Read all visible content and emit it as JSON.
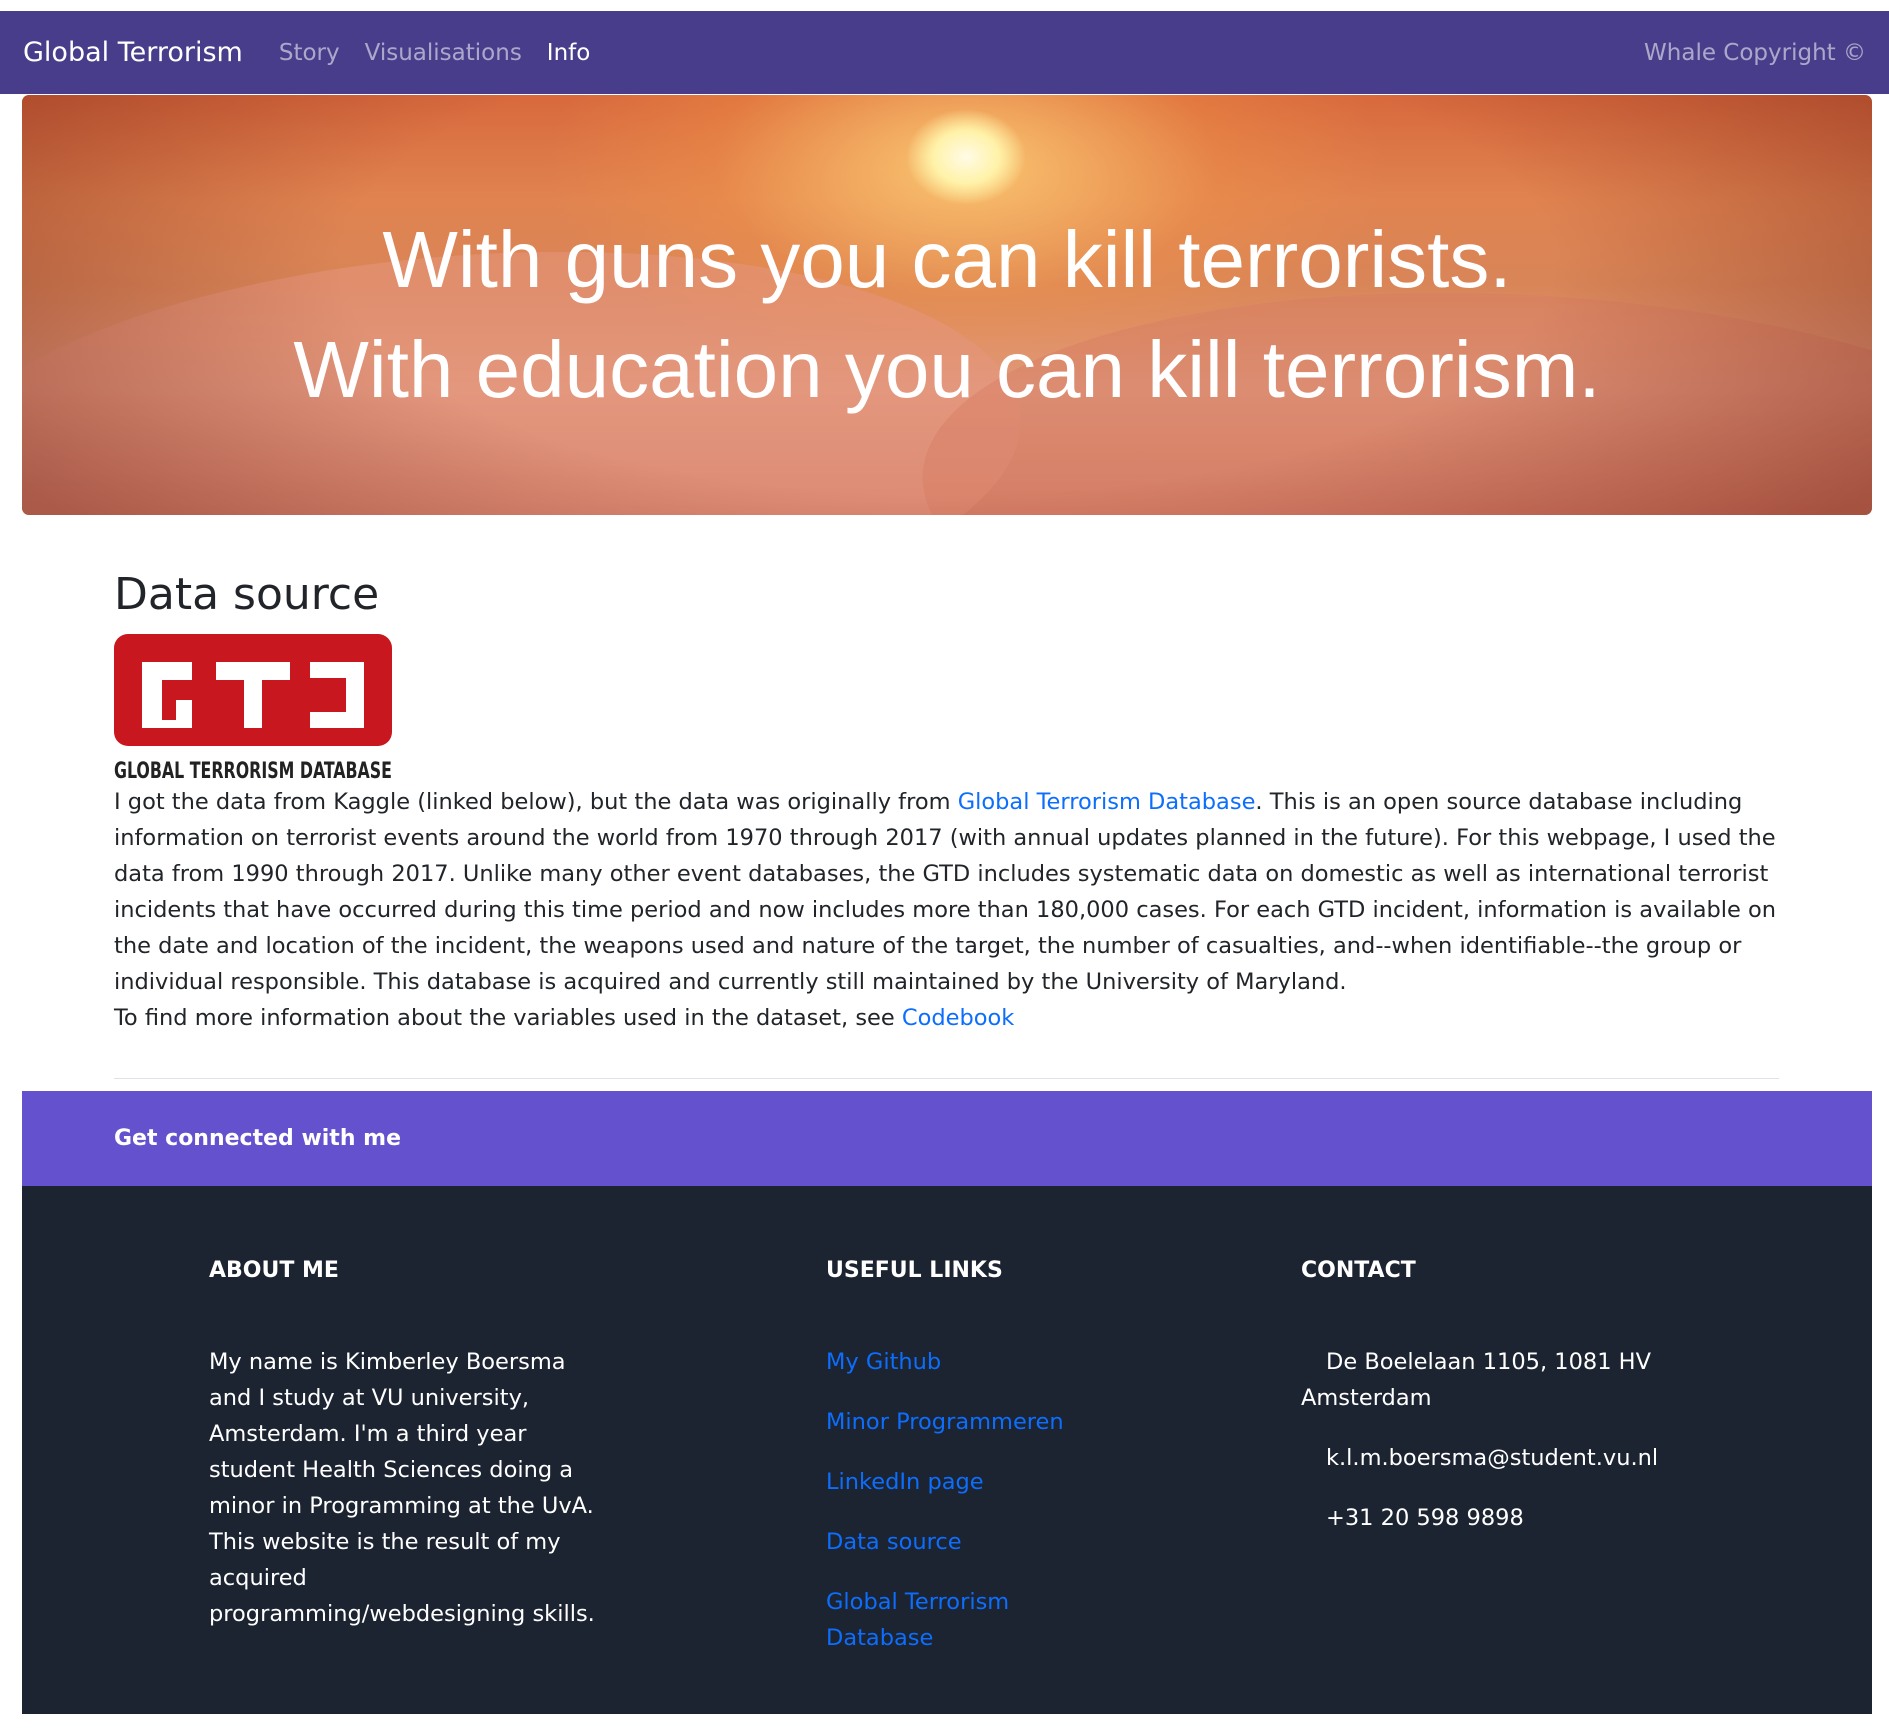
{
  "nav": {
    "brand": "Global Terrorism",
    "links": [
      "Story",
      "Visualisations",
      "Info"
    ],
    "active": "Info",
    "right": "Whale Copyright ©"
  },
  "hero": {
    "line1": "With guns you can kill terrorists.",
    "line2": "With education you can kill terrorism."
  },
  "data_source": {
    "title": "Data source",
    "logo_text": "GLOBAL TERRORISM DATABASE",
    "logo_letters": "GTD",
    "p1_before": "I got the data from Kaggle (linked below), but the data was originally from ",
    "p1_link": "Global Terrorism Database",
    "p1_after": ". This is an open source database including information on terrorist events around the world from 1970 through 2017 (with annual updates planned in the future). For this webpage, I used the data from 1990 through 2017. Unlike many other event databases, the GTD includes systematic data on domestic as well as international terrorist incidents that have occurred during this time period and now includes more than 180,000 cases. For each GTD incident, information is available on the date and location of the incident, the weapons used and nature of the target, the number of casualties, and--when identifiable--the group or individual responsible. This database is acquired and currently still maintained by the University of Maryland.",
    "p2_before": "To find more information about the variables used in the dataset, see ",
    "p2_link": "Codebook"
  },
  "connect": {
    "label": "Get connected with me"
  },
  "footer": {
    "about": {
      "heading": "About me",
      "text": "My name is Kimberley Boersma and I study at VU university, Amsterdam. I'm a third year student Health Sciences doing a minor in Programming at the UvA. This website is the result of my acquired programming/webdesigning skills."
    },
    "links": {
      "heading": "Useful links",
      "items": [
        "My Github",
        "Minor Programmeren",
        "LinkedIn page",
        "Data source",
        "Global Terrorism Database"
      ]
    },
    "contact": {
      "heading": "Contact",
      "address": "De Boelelaan 1105, 1081 HV Amsterdam",
      "email": "k.l.m.boersma@student.vu.nl",
      "phone": "+31 20 598 9898"
    }
  },
  "colors": {
    "navbar": "#483d8b",
    "connect_bar": "#6351ce",
    "footer": "#1c2331",
    "link": "#0d6efd",
    "gtd_red": "#c8171e"
  }
}
